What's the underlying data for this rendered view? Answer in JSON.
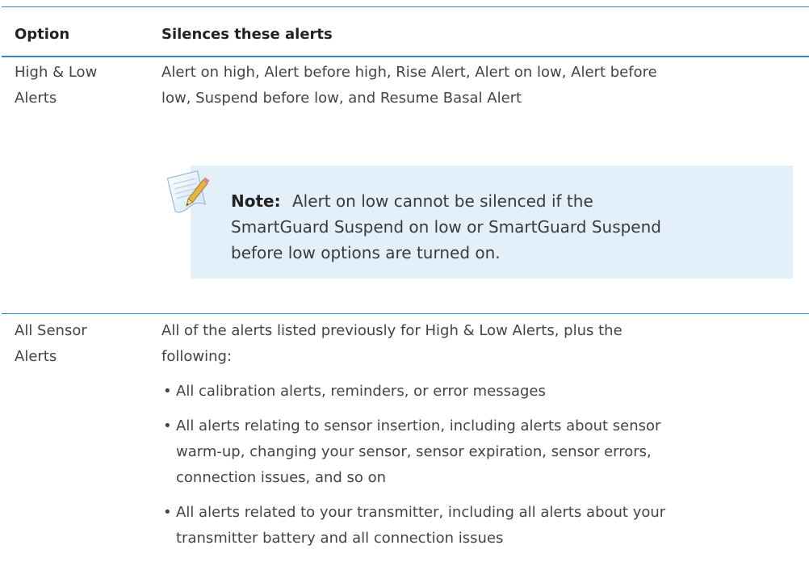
{
  "table": {
    "headers": {
      "option": "Option",
      "silences": "Silences these alerts"
    },
    "rows": [
      {
        "option_line1": "High & Low",
        "option_line2": "Alerts",
        "text_line1": "Alert on high, Alert before high, Rise Alert, Alert on low, Alert before",
        "text_line2": "low, Suspend before low, and Resume Basal Alert",
        "note": {
          "label": "Note:",
          "line1": "Alert on low cannot be silenced if the",
          "line2": "SmartGuard Suspend on low or SmartGuard Suspend",
          "line3": "before low options are turned on.",
          "icon": "notepad-pencil-icon"
        }
      },
      {
        "option_line1": "All Sensor",
        "option_line2": "Alerts",
        "text_line1": "All of the alerts listed previously for High & Low Alerts, plus the",
        "text_line2": "following:",
        "bullets": [
          {
            "line1": "All calibration alerts, reminders, or error messages"
          },
          {
            "line1": "All alerts relating to sensor insertion, including alerts about sensor",
            "line2": "warm-up, changing your sensor, sensor expiration, sensor errors,",
            "line3": "connection issues, and so on"
          },
          {
            "line1": "All alerts related to your transmitter, including all alerts about your",
            "line2": "transmitter battery and all connection issues"
          }
        ]
      }
    ]
  },
  "colors": {
    "rule": "#2f86c6",
    "note_background": "#e3f0fa",
    "text": "#444444"
  }
}
